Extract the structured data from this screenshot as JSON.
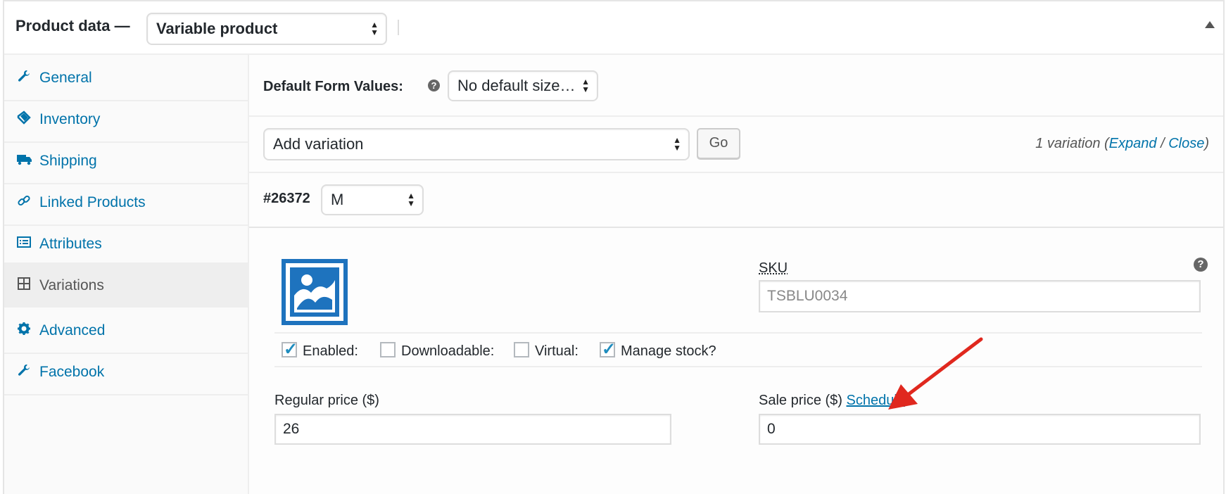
{
  "header": {
    "title": "Product data —",
    "product_type": "Variable product"
  },
  "sidebar": {
    "items": [
      {
        "label": "General",
        "icon": "wrench-icon"
      },
      {
        "label": "Inventory",
        "icon": "tag-icon"
      },
      {
        "label": "Shipping",
        "icon": "truck-icon"
      },
      {
        "label": "Linked Products",
        "icon": "link-icon"
      },
      {
        "label": "Attributes",
        "icon": "list-icon"
      },
      {
        "label": "Variations",
        "icon": "grid-icon",
        "active": true
      },
      {
        "label": "Advanced",
        "icon": "gear-icon"
      },
      {
        "label": "Facebook",
        "icon": "wrench-icon"
      }
    ]
  },
  "main": {
    "default_form_label": "Default Form Values:",
    "default_form_value": "No default size…",
    "add_variation_value": "Add variation",
    "go_label": "Go",
    "variation_count_prefix": "1 variation (",
    "expand_label": "Expand",
    "separator": " / ",
    "close_label": "Close",
    "variation_count_suffix": ")",
    "variation": {
      "id": "#26372",
      "attribute_value": "M",
      "sku_label": "SKU",
      "sku_value": "TSBLU0034",
      "checkboxes": [
        {
          "label": "Enabled:",
          "checked": true
        },
        {
          "label": "Downloadable:",
          "checked": false
        },
        {
          "label": "Virtual:",
          "checked": false
        },
        {
          "label": "Manage stock?",
          "checked": true
        }
      ],
      "regular_price_label": "Regular price ($)",
      "regular_price_value": "26",
      "sale_price_label": "Sale price ($)",
      "schedule_label": "Schedule",
      "sale_price_value": "0"
    }
  },
  "colors": {
    "link": "#0073aa",
    "accent": "#1e73be",
    "annotation_arrow": "#e0281e"
  }
}
